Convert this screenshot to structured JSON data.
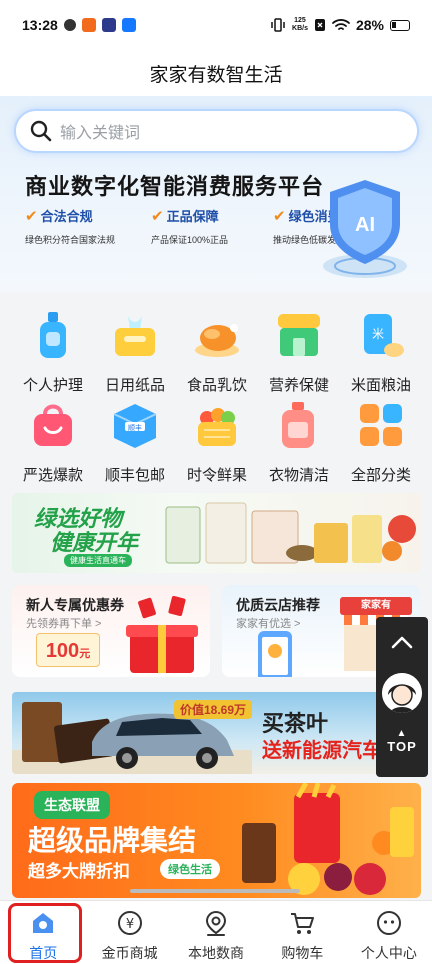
{
  "status_bar": {
    "time": "13:28",
    "net_speed_value": "125",
    "net_speed_unit": "KB/s",
    "battery": "28%"
  },
  "header": {
    "title": "家家有数智生活"
  },
  "search": {
    "placeholder": "输入关键词"
  },
  "hero": {
    "title": "商业数字化智能消费服务平台",
    "badge_text": "AI",
    "features": [
      {
        "title": "合法合规",
        "subtitle": "绿色积分符合国家法规"
      },
      {
        "title": "正品保障",
        "subtitle": "产品保证100%正品"
      },
      {
        "title": "绿色消费",
        "subtitle": "推动绿色低碳发展"
      }
    ]
  },
  "categories": [
    {
      "label": "个人护理",
      "icon": "lotion-bottle-icon"
    },
    {
      "label": "日用纸品",
      "icon": "tissue-box-icon"
    },
    {
      "label": "食品乳饮",
      "icon": "roast-chicken-icon"
    },
    {
      "label": "营养保健",
      "icon": "health-store-icon"
    },
    {
      "label": "米面粮油",
      "icon": "rice-bag-icon"
    },
    {
      "label": "严选爆款",
      "icon": "shopping-bag-icon"
    },
    {
      "label": "顺丰包邮",
      "icon": "parcel-box-icon"
    },
    {
      "label": "时令鲜果",
      "icon": "fruit-basket-icon"
    },
    {
      "label": "衣物清洁",
      "icon": "detergent-bottle-icon"
    },
    {
      "label": "全部分类",
      "icon": "grid-icon"
    }
  ],
  "promo_green": {
    "line1": "绿选好物",
    "line2": "健康开年",
    "subtitle": "健康生活直通车"
  },
  "cards": {
    "left": {
      "title": "新人专属优惠券",
      "subtitle": "先领券再下单 >",
      "coupon_value": "100",
      "coupon_unit": "元"
    },
    "right": {
      "title": "优质云店推荐",
      "subtitle": "家家有优选 >",
      "sign": "家家有"
    }
  },
  "tea_banner": {
    "price": "价值18.69万",
    "line1": "买茶叶",
    "line2": "送新能源汽车"
  },
  "orange_banner": {
    "badge": "生态联盟",
    "title": "超级品牌集结",
    "subtitle": "超多大牌折扣",
    "tag": "绿色生活"
  },
  "float": {
    "top_label": "TOP"
  },
  "bottom_nav": [
    {
      "label": "首页",
      "icon": "home-icon",
      "active": true
    },
    {
      "label": "金币商城",
      "icon": "coin-mall-icon"
    },
    {
      "label": "本地数商",
      "icon": "location-pin-icon"
    },
    {
      "label": "购物车",
      "icon": "cart-icon"
    },
    {
      "label": "个人中心",
      "icon": "profile-icon"
    }
  ],
  "colors": {
    "brand_blue": "#1a73e8",
    "green": "#23a24a",
    "orange": "#ff7a1f",
    "highlight_red": "#e02020"
  }
}
